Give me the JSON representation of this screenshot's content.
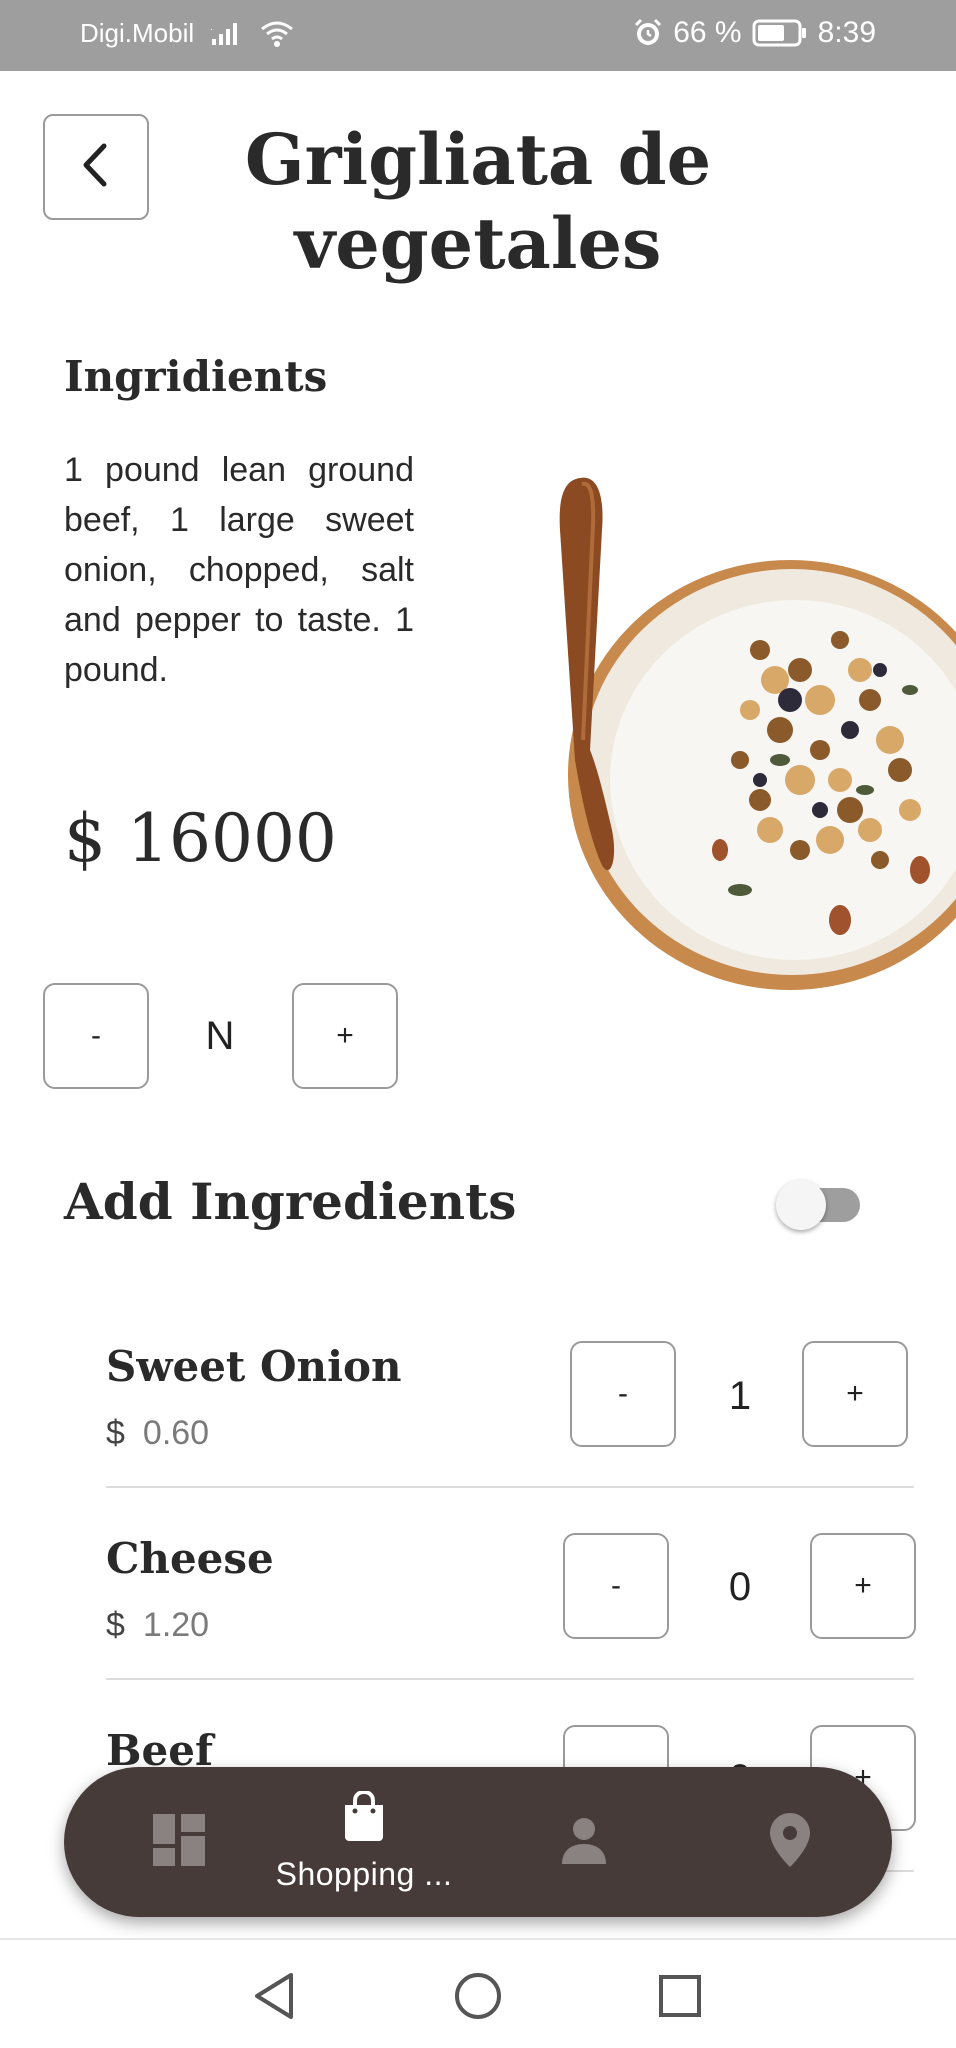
{
  "status_bar": {
    "carrier": "Digi.Mobil",
    "battery": "66 %",
    "time": "8:39"
  },
  "header": {
    "title": "Grigliata de vegetales"
  },
  "ingredients_section": {
    "heading": "Ingridients",
    "description": "1 pound lean ground beef, 1 large sweet onion, chopped, salt and pepper to taste. 1 pound."
  },
  "price": "$ 16000",
  "quantity": {
    "minus_label": "-",
    "value": "N",
    "plus_label": "+"
  },
  "add_ingredients": {
    "heading": "Add Ingredients",
    "toggle_on": false
  },
  "extras": [
    {
      "name": "Sweet Onion",
      "currency": "$",
      "price": "0.60",
      "qty": "1",
      "minus": "-",
      "plus": "+"
    },
    {
      "name": "Cheese",
      "currency": "$",
      "price": "1.20",
      "qty": "0",
      "minus": "-",
      "plus": "+"
    },
    {
      "name": "Beef",
      "currency": "$",
      "price": "",
      "qty": "0",
      "minus": "-",
      "plus": "+"
    }
  ],
  "bottom_nav": {
    "items": [
      {
        "icon": "dashboard-icon",
        "label": ""
      },
      {
        "icon": "shopping-bag-icon",
        "label": "Shopping ..."
      },
      {
        "icon": "person-icon",
        "label": ""
      },
      {
        "icon": "location-icon",
        "label": ""
      }
    ],
    "active_index": 1
  },
  "colors": {
    "nav_bg": "#463b38",
    "status_bar_bg": "#9e9e9e",
    "border": "#9a9a9a"
  }
}
